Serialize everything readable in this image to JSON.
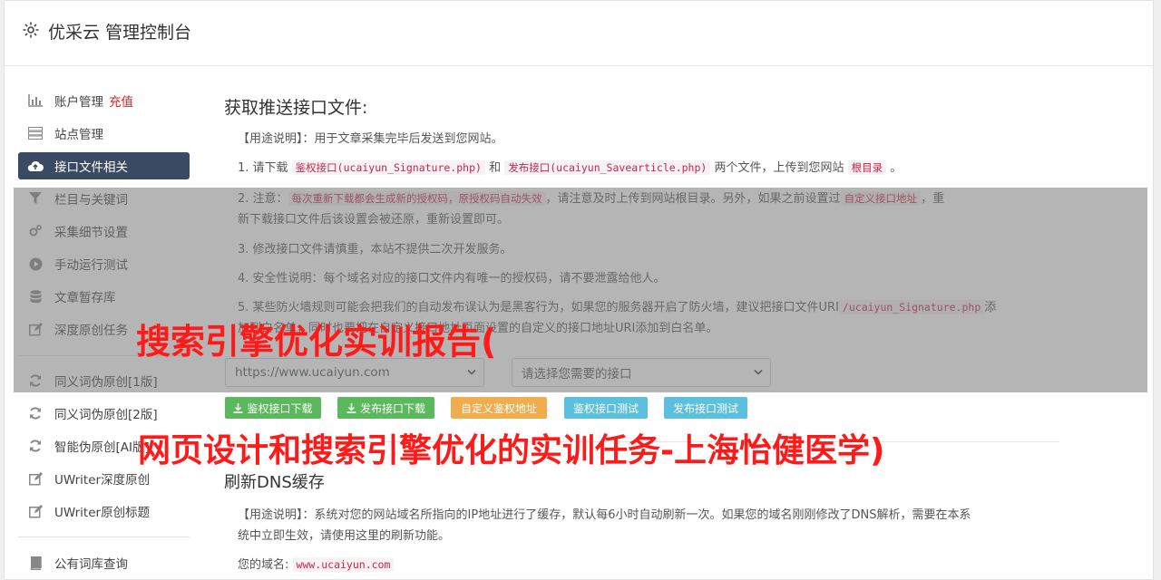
{
  "header": {
    "title": "优采云 管理控制台",
    "icon": "gear-icon"
  },
  "sidebar": {
    "items": [
      {
        "label": "账户管理",
        "badge": "充值",
        "icon": "bar-chart-icon"
      },
      {
        "label": "站点管理",
        "icon": "server-icon"
      },
      {
        "label": "接口文件相关",
        "icon": "cloud-upload-icon",
        "active": true
      },
      {
        "label": "栏目与关键词",
        "icon": "filter-icon"
      },
      {
        "label": "采集细节设置",
        "icon": "cogs-icon"
      },
      {
        "label": "手动运行测试",
        "icon": "play-icon"
      },
      {
        "label": "文章暂存库",
        "icon": "database-icon"
      },
      {
        "label": "深度原创任务",
        "icon": "edit-icon"
      },
      {
        "label": "同义词伪原创[1版]",
        "icon": "refresh-icon"
      },
      {
        "label": "同义词伪原创[2版]",
        "icon": "refresh-icon"
      },
      {
        "label": "智能伪原创[AI版]",
        "icon": "refresh-icon"
      },
      {
        "label": "UWriter深度原创",
        "icon": "edit-icon"
      },
      {
        "label": "UWriter原创标题",
        "icon": "edit-icon"
      },
      {
        "label": "公有词库查询",
        "icon": "book-icon"
      }
    ]
  },
  "section1": {
    "title": "获取推送接口文件:",
    "usage_label": "【用途说明】",
    "usage_text": "：用于文章采集完毕后发送到您网站。",
    "line1": {
      "a": "1. 请下载",
      "code1": "鉴权接口(ucaiyun_Signature.php)",
      "b": "和",
      "code2": "发布接口(ucaiyun_Savearticle.php)",
      "c": "两个文件，上传到您网站",
      "code3": "根目录",
      "d": "。"
    },
    "line2": {
      "a": "2. 注意：",
      "code1": "每次重新下载都会生成新的授权码，原授权码自动失效",
      "b": "，请注意及时上传到网站根目录。另外，如果之前设置过",
      "code2": "自定义接口地址",
      "c": "，重",
      "d": "新下载接口文件后该设置会被还原，重新设置即可。"
    },
    "line3": "3. 修改接口文件请慎重，本站不提供二次开发服务。",
    "line4": "4. 安全性说明：每个域名对应的接口文件内有唯一的授权码，请不要泄露给他人。",
    "line5": {
      "a": "5. 某些防火墙规则可能会把我们的自动发布误认为是黑客行为，如果您的服务器开启了防火墙，建议把接口文件URI",
      "code1": "/ucaiyun_Signature.php",
      "b": "添",
      "c": "加到白名单，同时也要把在自定义接口地址页面设置的自定义的接口地址URI添加到白名单。"
    },
    "domain_select": "https://www.ucaiyun.com",
    "api_select": "请选择您需要的接口",
    "buttons": [
      {
        "label": "鉴权接口下载",
        "icon": "download-icon",
        "color": "#5cb85c"
      },
      {
        "label": "发布接口下载",
        "icon": "download-icon",
        "color": "#5cb85c"
      },
      {
        "label": "自定义鉴权地址",
        "color": "#f0ad4e"
      },
      {
        "label": "鉴权接口测试",
        "color": "#5bc0de"
      },
      {
        "label": "发布接口测试",
        "color": "#5bc0de"
      }
    ]
  },
  "section2": {
    "title": "刷新DNS缓存",
    "usage_label": "【用途说明】",
    "usage_text": "：系统对您的网站域名所指向的IP地址进行了缓存，默认每6小时自动刷新一次。如果您的域名刚刚修改了DNS解析，需要在本系",
    "usage_text2": "统中立即生效，请使用这里的刷新功能。",
    "domain_label": "您的域名:",
    "domain_value": "www.ucaiyun.com"
  },
  "watermark": {
    "line1": "搜索引擎优化实训报告(",
    "line2": "网页设计和搜索引擎优化的实训任务-上海怡健医学)"
  },
  "colors": {
    "active_nav": "#3a4a63",
    "code": "#c7254e",
    "watermark": "#ff1a1a"
  }
}
